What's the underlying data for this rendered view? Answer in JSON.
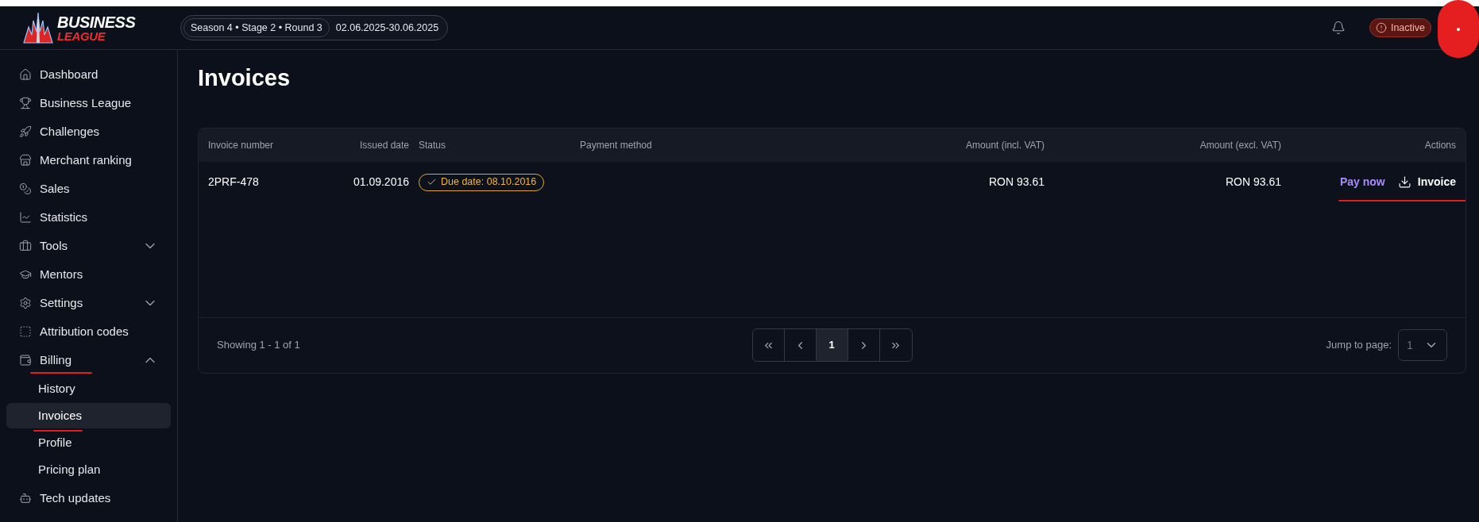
{
  "header": {
    "logo": {
      "line1": "BUSINESS",
      "line2": "LEAGUE"
    },
    "season": "Season 4 • Stage 2 • Round 3",
    "dates": "02.06.2025-30.06.2025",
    "status_badge": "Inactive"
  },
  "sidebar": {
    "items": [
      {
        "label": "Dashboard",
        "selected": false
      },
      {
        "label": "Business League",
        "selected": false
      },
      {
        "label": "Challenges",
        "selected": false
      },
      {
        "label": "Merchant ranking",
        "selected": false
      },
      {
        "label": "Sales",
        "selected": false
      },
      {
        "label": "Statistics",
        "selected": false
      },
      {
        "label": "Tools",
        "selected": false,
        "expanded": false
      },
      {
        "label": "Mentors",
        "selected": false
      },
      {
        "label": "Settings",
        "selected": false,
        "expanded": false
      },
      {
        "label": "Attribution codes",
        "selected": false
      },
      {
        "label": "Billing",
        "selected": false,
        "expanded": true,
        "marked": true,
        "children": [
          {
            "label": "History",
            "selected": false,
            "marked": false
          },
          {
            "label": "Invoices",
            "selected": true,
            "marked": true
          },
          {
            "label": "Profile",
            "selected": false,
            "marked": false
          },
          {
            "label": "Pricing plan",
            "selected": false,
            "marked": false
          }
        ]
      },
      {
        "label": "Tech updates",
        "selected": false
      }
    ]
  },
  "page": {
    "title": "Invoices"
  },
  "table": {
    "columns": [
      "Invoice number",
      "Issued date",
      "Status",
      "Payment method",
      "Amount (incl. VAT)",
      "Amount (excl. VAT)",
      "Actions"
    ],
    "rows": [
      {
        "invoice_number": "2PRF-478",
        "issued_date": "01.09.2016",
        "status": "Due date: 08.10.2016",
        "amount_incl": "RON 93.61",
        "amount_excl": "RON 93.61",
        "pay_action": "Pay now",
        "download_action": "Invoice",
        "marked": true
      }
    ]
  },
  "pagination": {
    "summary": "Showing 1 - 1 of 1",
    "pages": [
      {
        "label": "1",
        "selected": true
      }
    ],
    "jump_label": "Jump to page:",
    "jump_value": "1"
  }
}
